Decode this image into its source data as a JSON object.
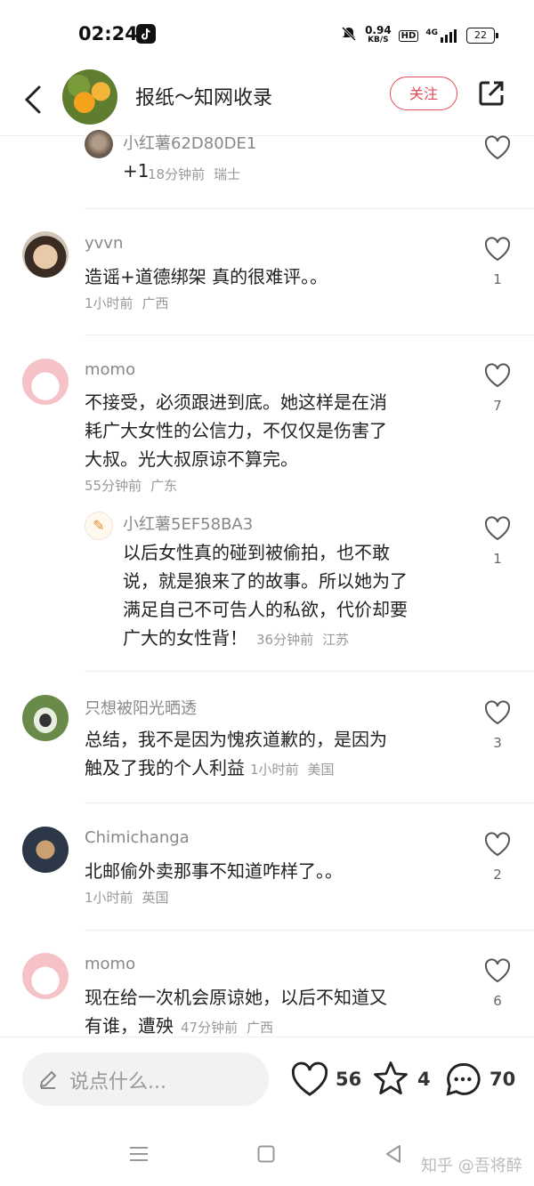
{
  "status": {
    "time": "02:24",
    "speed_value": "0.94",
    "speed_unit": "KB/S",
    "hd": "HD",
    "signal": "4G",
    "battery": "22"
  },
  "header": {
    "title": "报纸～知网收录",
    "follow_label": "关注"
  },
  "comments": [
    {
      "name": "小红薯62D80DE1",
      "text": "+1",
      "time": "18分钟前",
      "location": "瑞士",
      "likes": ""
    },
    {
      "name": "yvvn",
      "text": "造谣+道德绑架 真的很难评。。",
      "time": "1小时前",
      "location": "广西",
      "likes": "1"
    },
    {
      "name": "momo",
      "lines": [
        "不接受，必须跟进到底。她这样是在消",
        "耗广大女性的公信力，不仅仅是伤害了",
        "大叔。光大叔原谅不算完。"
      ],
      "time": "55分钟前",
      "location": "广东",
      "likes": "7"
    },
    {
      "name": "小红薯5EF58BA3",
      "lines": [
        "以后女性真的碰到被偷拍，也不敢",
        "说，就是狼来了的故事。所以她为了",
        "满足自己不可告人的私欲，代价却要",
        "广大的女性背！"
      ],
      "time": "36分钟前",
      "location": "江苏",
      "likes": "1"
    },
    {
      "name": "只想被阳光晒透",
      "lines": [
        "总结，我不是因为愧疚道歉的，是因为",
        "触及了我的个人利益"
      ],
      "time": "1小时前",
      "location": "美国",
      "likes": "3"
    },
    {
      "name": "Chimichanga",
      "text": "北邮偷外卖那事不知道咋样了。。",
      "time": "1小时前",
      "location": "英国",
      "likes": "2"
    },
    {
      "name": "momo",
      "lines": [
        "现在给一次机会原谅她，以后不知道又",
        "有谁，遭殃"
      ],
      "time": "47分钟前",
      "location": "广西",
      "likes": "6"
    }
  ],
  "bottom": {
    "placeholder": "说点什么...",
    "likes": "56",
    "stars": "4",
    "comments": "70"
  },
  "watermark": "知乎 @吾将醉",
  "colors": {
    "accent": "#e24b5a",
    "muted": "#999999"
  }
}
